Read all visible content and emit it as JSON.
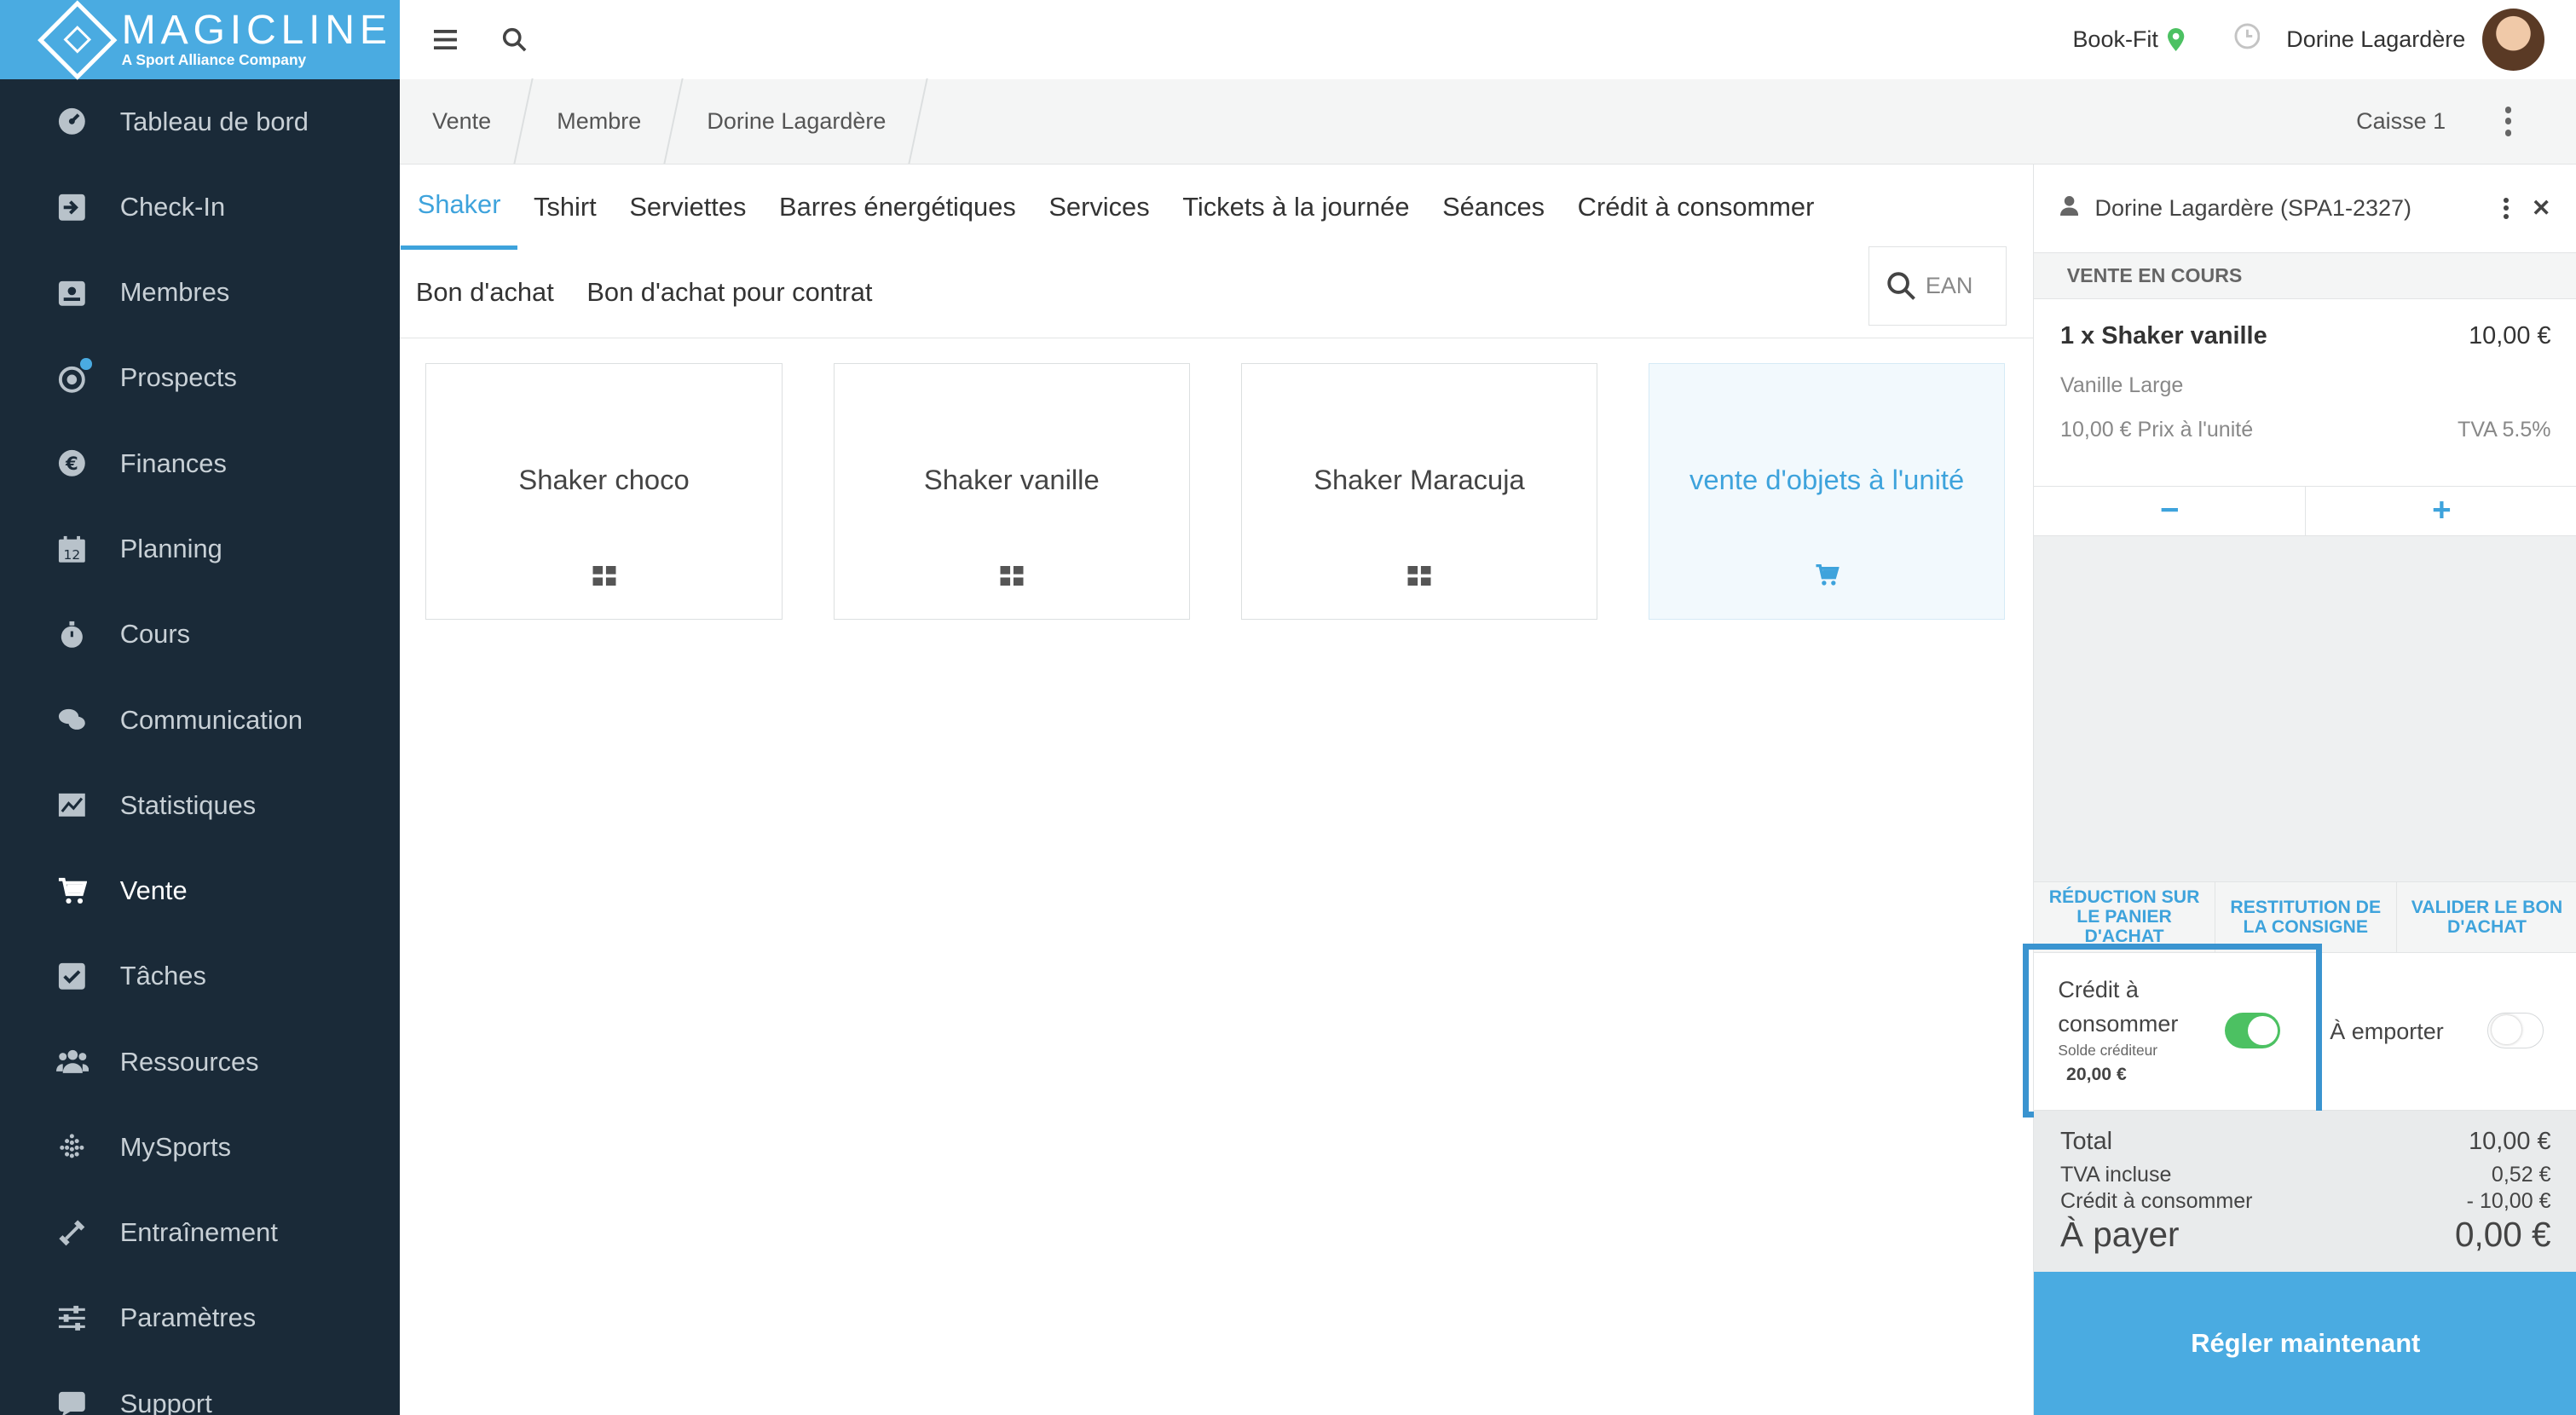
{
  "brand": {
    "title": "MAGICLINE",
    "subtitle": "A Sport Alliance Company",
    "color": "#4aabe1"
  },
  "sidebar": {
    "items": [
      {
        "label": "Tableau de bord",
        "icon": "dashboard-icon"
      },
      {
        "label": "Check-In",
        "icon": "check-in-icon"
      },
      {
        "label": "Membres",
        "icon": "members-icon"
      },
      {
        "label": "Prospects",
        "icon": "prospects-icon"
      },
      {
        "label": "Finances",
        "icon": "euro-icon"
      },
      {
        "label": "Planning",
        "icon": "calendar-icon"
      },
      {
        "label": "Cours",
        "icon": "stopwatch-icon"
      },
      {
        "label": "Communication",
        "icon": "chat-icon"
      },
      {
        "label": "Statistiques",
        "icon": "chart-icon"
      },
      {
        "label": "Vente",
        "icon": "cart-icon",
        "active": true
      },
      {
        "label": "Tâches",
        "icon": "checkbox-icon"
      },
      {
        "label": "Ressources",
        "icon": "people-icon"
      },
      {
        "label": "MySports",
        "icon": "mysports-icon"
      },
      {
        "label": "Entraînement",
        "icon": "dumbbell-icon"
      },
      {
        "label": "Paramètres",
        "icon": "sliders-icon"
      },
      {
        "label": "Support",
        "icon": "support-icon"
      }
    ]
  },
  "topbar": {
    "studio": "Book-Fit",
    "user": "Dorine Lagardère"
  },
  "breadcrumb": {
    "items": [
      "Vente",
      "Membre",
      "Dorine Lagardère"
    ],
    "register": "Caisse 1"
  },
  "tabs": {
    "row1": [
      "Shaker",
      "Tshirt",
      "Serviettes",
      "Barres énergétiques",
      "Services",
      "Tickets à la journée",
      "Séances",
      "Crédit à consommer"
    ],
    "row2": [
      "Bon d'achat",
      "Bon d'achat pour contrat"
    ],
    "active": "Shaker",
    "search_placeholder": "EAN"
  },
  "products": [
    {
      "name": "Shaker choco",
      "icon": "grid-icon"
    },
    {
      "name": "Shaker vanille",
      "icon": "grid-icon"
    },
    {
      "name": "Shaker Maracuja",
      "icon": "grid-icon"
    },
    {
      "name": "vente d'objets à l'unité",
      "icon": "cart-icon",
      "special": true
    }
  ],
  "panel": {
    "customer": "Dorine Lagardère (SPA1-2327)",
    "section": "VENTE EN COURS",
    "line": {
      "name": "1 x Shaker vanille",
      "price": "10,00 €",
      "variant": "Vanille Large",
      "unit": "10,00 € Prix à l'unité",
      "tax": "TVA 5.5%"
    },
    "actions": [
      "RÉDUCTION SUR LE PANIER D'ACHAT",
      "RESTITUTION DE LA CONSIGNE",
      "VALIDER LE BON D'ACHAT"
    ],
    "credit": {
      "label": "Crédit à consommer",
      "solde_label": "Solde créditeur",
      "solde_value": "20,00 €",
      "enabled": true
    },
    "takeaway": {
      "label": "À emporter",
      "enabled": false
    },
    "totals": {
      "total_label": "Total",
      "total": "10,00 €",
      "tva_label": "TVA incluse",
      "tva": "0,52 €",
      "credit_label": "Crédit à consommer",
      "credit": "- 10,00 €",
      "pay_label": "À payer",
      "pay": "0,00 €"
    },
    "pay_button": "Régler maintenant"
  }
}
